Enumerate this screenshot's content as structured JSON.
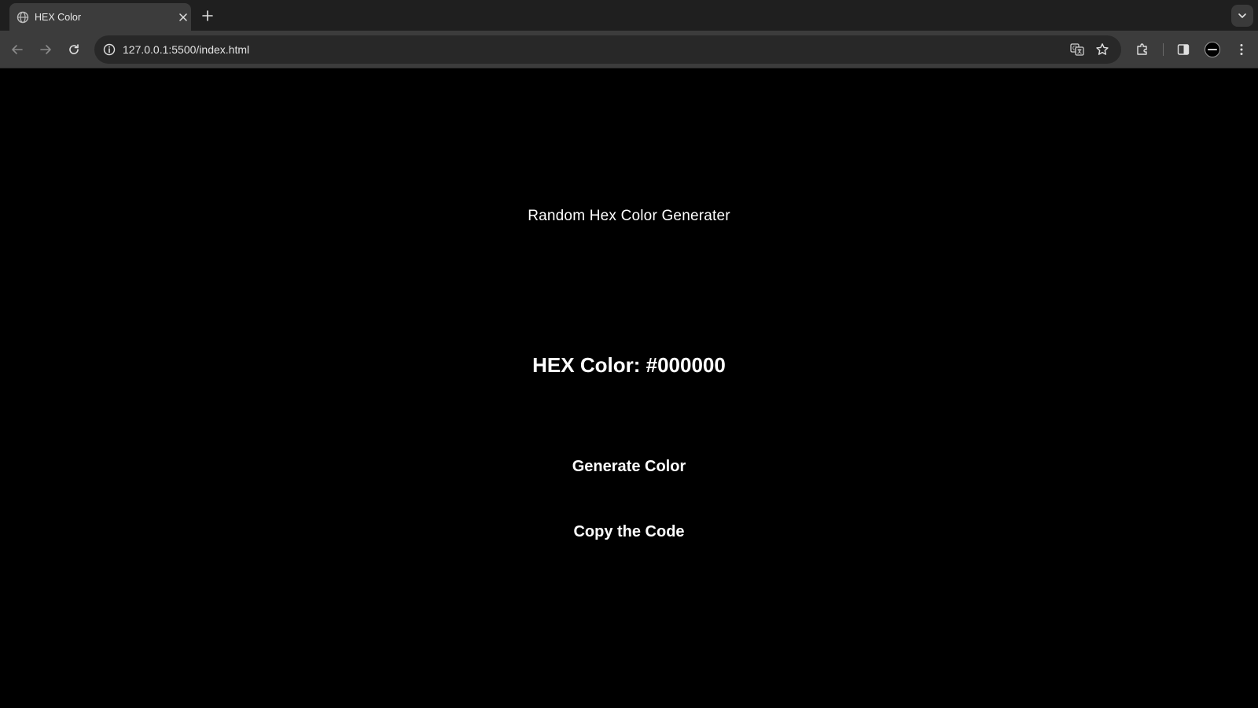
{
  "browser": {
    "tab": {
      "title": "HEX Color"
    },
    "address_bar": {
      "url": "127.0.0.1:5500/index.html"
    }
  },
  "page": {
    "title": "Random Hex Color Generater",
    "hex_label": "HEX Color: #000000",
    "current_color": "#000000",
    "buttons": {
      "generate": "Generate Color",
      "copy": "Copy the Code"
    }
  },
  "icons": {
    "tab_favicon": "globe-icon",
    "tab_close": "close-icon",
    "new_tab": "plus-icon",
    "tab_search": "chevron-down-icon",
    "back": "arrow-left-icon",
    "forward": "arrow-right-icon",
    "reload": "reload-icon",
    "site_info": "info-icon",
    "translate": "translate-icon",
    "bookmark": "star-icon",
    "extensions": "puzzle-icon",
    "side_panel": "side-panel-icon",
    "profile": "avatar-icon",
    "menu": "kebab-menu-icon"
  },
  "colors": {
    "tabstrip_bg": "#1f1f1f",
    "active_tab_bg": "#3c3c3c",
    "toolbar_bg": "#3c3c3c",
    "omnibox_bg": "#282828",
    "page_bg": "#000000",
    "page_text": "#ffffff"
  }
}
